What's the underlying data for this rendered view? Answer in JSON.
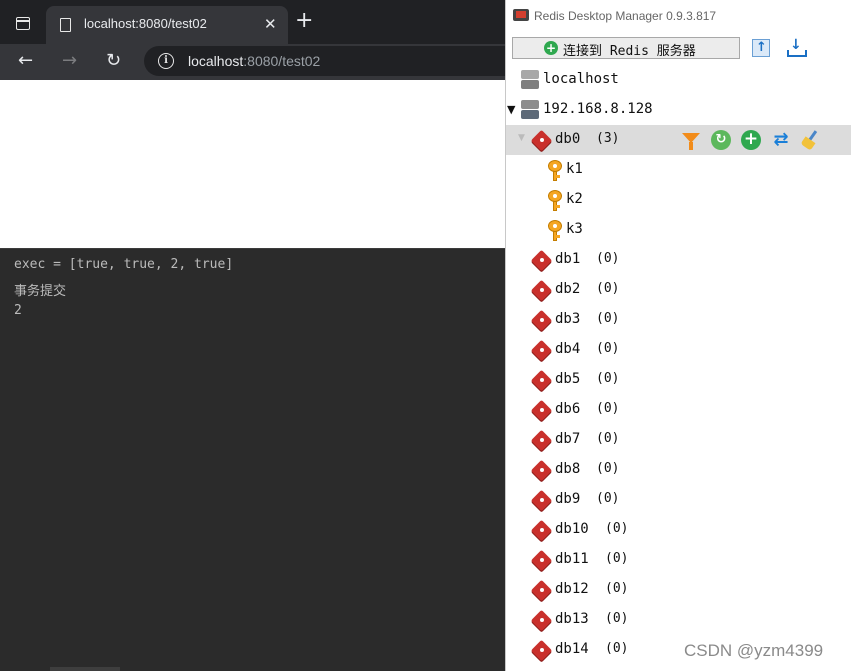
{
  "browser": {
    "tab_title": "localhost:8080/test02",
    "tab_close": "✕",
    "new_tab": "+",
    "nav": {
      "back": "←",
      "forward": "→",
      "reload": "↻"
    },
    "url_host": "localhost",
    "url_rest": ":8080/test02",
    "info_glyph": "i"
  },
  "console": {
    "lines": [
      "exec = [true, true, 2, true]",
      "事务提交",
      "2"
    ]
  },
  "rdm": {
    "window_title": "Redis Desktop Manager 0.9.3.817",
    "connect_label": "连接到 Redis 服务器",
    "connect_icon": "+",
    "servers": [
      {
        "name": "localhost",
        "expanded": false
      },
      {
        "name": "192.168.8.128",
        "expanded": true,
        "expander_glyph": "▼"
      }
    ],
    "selected_db": {
      "name": "db0",
      "count": "(3)",
      "expander_glyph": "▼",
      "keys": [
        "k1",
        "k2",
        "k3"
      ],
      "actions": {
        "reload_glyph": "↻",
        "add_glyph": "+",
        "swap_glyph": "⇄"
      }
    },
    "databases": [
      {
        "name": "db1",
        "count": "(0)"
      },
      {
        "name": "db2",
        "count": "(0)"
      },
      {
        "name": "db3",
        "count": "(0)"
      },
      {
        "name": "db4",
        "count": "(0)"
      },
      {
        "name": "db5",
        "count": "(0)"
      },
      {
        "name": "db6",
        "count": "(0)"
      },
      {
        "name": "db7",
        "count": "(0)"
      },
      {
        "name": "db8",
        "count": "(0)"
      },
      {
        "name": "db9",
        "count": "(0)"
      },
      {
        "name": "db10",
        "count": "(0)"
      },
      {
        "name": "db11",
        "count": "(0)"
      },
      {
        "name": "db12",
        "count": "(0)"
      },
      {
        "name": "db13",
        "count": "(0)"
      },
      {
        "name": "db14",
        "count": "(0)"
      }
    ]
  },
  "watermark": "CSDN @yzm4399"
}
